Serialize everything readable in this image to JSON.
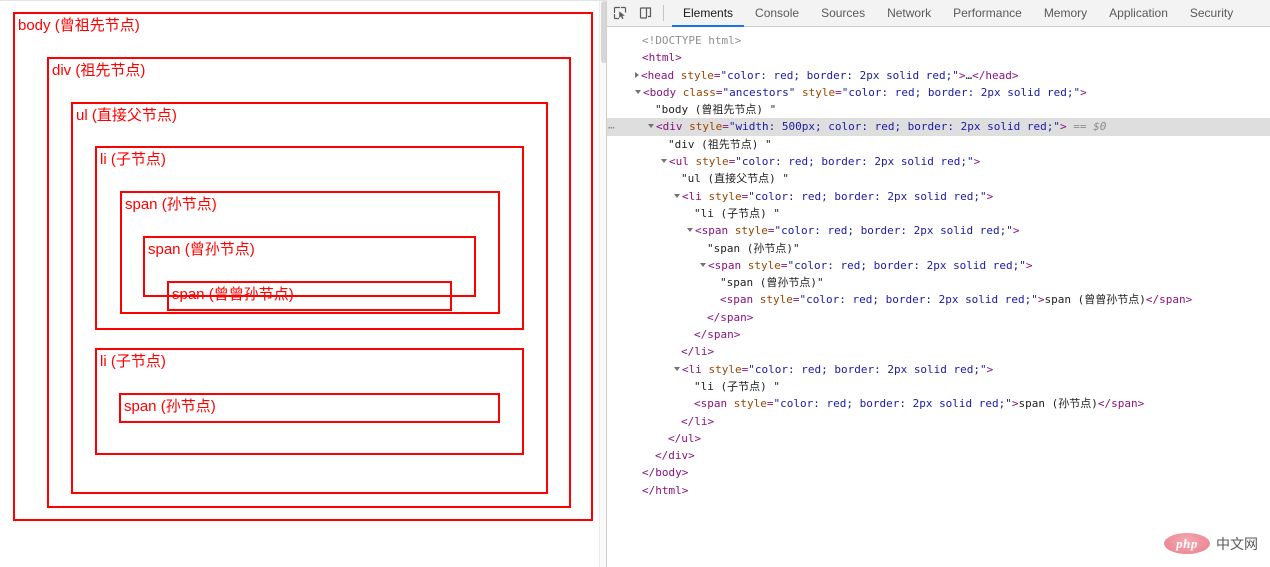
{
  "page_pane": {
    "boxes": {
      "body": "body (曾祖先节点)",
      "div": "div (祖先节点)",
      "ul": "ul (直接父节点)",
      "li_1": "li (子节点)",
      "span_sun_1": "span (孙节点)",
      "span_zengsun": "span (曾孙节点)",
      "span_zengzengsun": "span (曾曾孙节点)",
      "li_2": "li (子节点)",
      "span_sun_2": "span (孙节点)"
    },
    "border_color": "#ff0000",
    "text_color": "#ff0000"
  },
  "devtools": {
    "toolbar": {
      "inspect_icon": "inspect-element-icon",
      "device_icon": "device-toolbar-icon",
      "tabs": [
        {
          "label": "Elements",
          "active": true
        },
        {
          "label": "Console",
          "active": false
        },
        {
          "label": "Sources",
          "active": false
        },
        {
          "label": "Network",
          "active": false
        },
        {
          "label": "Performance",
          "active": false
        },
        {
          "label": "Memory",
          "active": false
        },
        {
          "label": "Application",
          "active": false
        },
        {
          "label": "Security",
          "active": false
        }
      ],
      "accent_color": "#1a73e8"
    },
    "dom_lines": [
      {
        "indent": 0,
        "twisty": "none",
        "selected": false,
        "dots": false,
        "parts": [
          {
            "c": "doctype",
            "t": "<!DOCTYPE html>"
          }
        ]
      },
      {
        "indent": 0,
        "twisty": "none",
        "selected": false,
        "dots": false,
        "parts": [
          {
            "c": "punct",
            "t": "<"
          },
          {
            "c": "tag",
            "t": "html"
          },
          {
            "c": "punct",
            "t": ">"
          }
        ]
      },
      {
        "indent": 0,
        "twisty": "closed",
        "selected": false,
        "dots": false,
        "parts": [
          {
            "c": "punct",
            "t": "<"
          },
          {
            "c": "tag",
            "t": "head"
          },
          {
            "c": "txt",
            "t": " "
          },
          {
            "c": "attrname",
            "t": "style"
          },
          {
            "c": "punct",
            "t": "="
          },
          {
            "c": "attrval",
            "t": "\"color: red; border: 2px solid red;\""
          },
          {
            "c": "punct",
            "t": ">"
          },
          {
            "c": "txt",
            "t": "…"
          },
          {
            "c": "punct",
            "t": "</"
          },
          {
            "c": "tag",
            "t": "head"
          },
          {
            "c": "punct",
            "t": ">"
          }
        ]
      },
      {
        "indent": 0,
        "twisty": "open",
        "selected": false,
        "dots": false,
        "parts": [
          {
            "c": "punct",
            "t": "<"
          },
          {
            "c": "tag",
            "t": "body"
          },
          {
            "c": "txt",
            "t": " "
          },
          {
            "c": "attrname",
            "t": "class"
          },
          {
            "c": "punct",
            "t": "="
          },
          {
            "c": "attrval",
            "t": "\"ancestors\""
          },
          {
            "c": "txt",
            "t": " "
          },
          {
            "c": "attrname",
            "t": "style"
          },
          {
            "c": "punct",
            "t": "="
          },
          {
            "c": "attrval",
            "t": "\"color: red; border: 2px solid red;\""
          },
          {
            "c": "punct",
            "t": ">"
          }
        ]
      },
      {
        "indent": 1,
        "twisty": "none",
        "selected": false,
        "dots": false,
        "parts": [
          {
            "c": "txt",
            "t": "\"body (曾祖先节点) \""
          }
        ]
      },
      {
        "indent": 1,
        "twisty": "open",
        "selected": true,
        "dots": true,
        "parts": [
          {
            "c": "punct",
            "t": "<"
          },
          {
            "c": "tag",
            "t": "div"
          },
          {
            "c": "txt",
            "t": " "
          },
          {
            "c": "attrname",
            "t": "style"
          },
          {
            "c": "punct",
            "t": "="
          },
          {
            "c": "attrval",
            "t": "\"width: 500px; color: red; border: 2px solid red;\""
          },
          {
            "c": "punct",
            "t": ">"
          },
          {
            "c": "dollar",
            "t": " == $0"
          }
        ]
      },
      {
        "indent": 2,
        "twisty": "none",
        "selected": false,
        "dots": false,
        "parts": [
          {
            "c": "txt",
            "t": "\"div (祖先节点) \""
          }
        ]
      },
      {
        "indent": 2,
        "twisty": "open",
        "selected": false,
        "dots": false,
        "parts": [
          {
            "c": "punct",
            "t": "<"
          },
          {
            "c": "tag",
            "t": "ul"
          },
          {
            "c": "txt",
            "t": " "
          },
          {
            "c": "attrname",
            "t": "style"
          },
          {
            "c": "punct",
            "t": "="
          },
          {
            "c": "attrval",
            "t": "\"color: red; border: 2px solid red;\""
          },
          {
            "c": "punct",
            "t": ">"
          }
        ]
      },
      {
        "indent": 3,
        "twisty": "none",
        "selected": false,
        "dots": false,
        "parts": [
          {
            "c": "txt",
            "t": "\"ul (直接父节点) \""
          }
        ]
      },
      {
        "indent": 3,
        "twisty": "open",
        "selected": false,
        "dots": false,
        "parts": [
          {
            "c": "punct",
            "t": "<"
          },
          {
            "c": "tag",
            "t": "li"
          },
          {
            "c": "txt",
            "t": " "
          },
          {
            "c": "attrname",
            "t": "style"
          },
          {
            "c": "punct",
            "t": "="
          },
          {
            "c": "attrval",
            "t": "\"color: red; border: 2px solid red;\""
          },
          {
            "c": "punct",
            "t": ">"
          }
        ]
      },
      {
        "indent": 4,
        "twisty": "none",
        "selected": false,
        "dots": false,
        "parts": [
          {
            "c": "txt",
            "t": "\"li (子节点) \""
          }
        ]
      },
      {
        "indent": 4,
        "twisty": "open",
        "selected": false,
        "dots": false,
        "parts": [
          {
            "c": "punct",
            "t": "<"
          },
          {
            "c": "tag",
            "t": "span"
          },
          {
            "c": "txt",
            "t": " "
          },
          {
            "c": "attrname",
            "t": "style"
          },
          {
            "c": "punct",
            "t": "="
          },
          {
            "c": "attrval",
            "t": "\"color: red; border: 2px solid red;\""
          },
          {
            "c": "punct",
            "t": ">"
          }
        ]
      },
      {
        "indent": 5,
        "twisty": "none",
        "selected": false,
        "dots": false,
        "parts": [
          {
            "c": "txt",
            "t": "\"span (孙节点)\""
          }
        ]
      },
      {
        "indent": 5,
        "twisty": "open",
        "selected": false,
        "dots": false,
        "parts": [
          {
            "c": "punct",
            "t": "<"
          },
          {
            "c": "tag",
            "t": "span"
          },
          {
            "c": "txt",
            "t": " "
          },
          {
            "c": "attrname",
            "t": "style"
          },
          {
            "c": "punct",
            "t": "="
          },
          {
            "c": "attrval",
            "t": "\"color: red; border: 2px solid red;\""
          },
          {
            "c": "punct",
            "t": ">"
          }
        ]
      },
      {
        "indent": 6,
        "twisty": "none",
        "selected": false,
        "dots": false,
        "parts": [
          {
            "c": "txt",
            "t": "\"span (曾孙节点)\""
          }
        ]
      },
      {
        "indent": 6,
        "twisty": "none",
        "selected": false,
        "dots": false,
        "parts": [
          {
            "c": "punct",
            "t": "<"
          },
          {
            "c": "tag",
            "t": "span"
          },
          {
            "c": "txt",
            "t": " "
          },
          {
            "c": "attrname",
            "t": "style"
          },
          {
            "c": "punct",
            "t": "="
          },
          {
            "c": "attrval",
            "t": "\"color: red; border: 2px solid red;\""
          },
          {
            "c": "punct",
            "t": ">"
          },
          {
            "c": "txt",
            "t": "span (曾曾孙节点)"
          },
          {
            "c": "punct",
            "t": "</"
          },
          {
            "c": "tag",
            "t": "span"
          },
          {
            "c": "punct",
            "t": ">"
          }
        ]
      },
      {
        "indent": 5,
        "twisty": "none",
        "selected": false,
        "dots": false,
        "parts": [
          {
            "c": "punct",
            "t": "</"
          },
          {
            "c": "tag",
            "t": "span"
          },
          {
            "c": "punct",
            "t": ">"
          }
        ]
      },
      {
        "indent": 4,
        "twisty": "none",
        "selected": false,
        "dots": false,
        "parts": [
          {
            "c": "punct",
            "t": "</"
          },
          {
            "c": "tag",
            "t": "span"
          },
          {
            "c": "punct",
            "t": ">"
          }
        ]
      },
      {
        "indent": 3,
        "twisty": "none",
        "selected": false,
        "dots": false,
        "parts": [
          {
            "c": "punct",
            "t": "</"
          },
          {
            "c": "tag",
            "t": "li"
          },
          {
            "c": "punct",
            "t": ">"
          }
        ]
      },
      {
        "indent": 3,
        "twisty": "open",
        "selected": false,
        "dots": false,
        "parts": [
          {
            "c": "punct",
            "t": "<"
          },
          {
            "c": "tag",
            "t": "li"
          },
          {
            "c": "txt",
            "t": " "
          },
          {
            "c": "attrname",
            "t": "style"
          },
          {
            "c": "punct",
            "t": "="
          },
          {
            "c": "attrval",
            "t": "\"color: red; border: 2px solid red;\""
          },
          {
            "c": "punct",
            "t": ">"
          }
        ]
      },
      {
        "indent": 4,
        "twisty": "none",
        "selected": false,
        "dots": false,
        "parts": [
          {
            "c": "txt",
            "t": "\"li (子节点) \""
          }
        ]
      },
      {
        "indent": 4,
        "twisty": "none",
        "selected": false,
        "dots": false,
        "parts": [
          {
            "c": "punct",
            "t": "<"
          },
          {
            "c": "tag",
            "t": "span"
          },
          {
            "c": "txt",
            "t": " "
          },
          {
            "c": "attrname",
            "t": "style"
          },
          {
            "c": "punct",
            "t": "="
          },
          {
            "c": "attrval",
            "t": "\"color: red; border: 2px solid red;\""
          },
          {
            "c": "punct",
            "t": ">"
          },
          {
            "c": "txt",
            "t": "span (孙节点)"
          },
          {
            "c": "punct",
            "t": "</"
          },
          {
            "c": "tag",
            "t": "span"
          },
          {
            "c": "punct",
            "t": ">"
          }
        ]
      },
      {
        "indent": 3,
        "twisty": "none",
        "selected": false,
        "dots": false,
        "parts": [
          {
            "c": "punct",
            "t": "</"
          },
          {
            "c": "tag",
            "t": "li"
          },
          {
            "c": "punct",
            "t": ">"
          }
        ]
      },
      {
        "indent": 2,
        "twisty": "none",
        "selected": false,
        "dots": false,
        "parts": [
          {
            "c": "punct",
            "t": "</"
          },
          {
            "c": "tag",
            "t": "ul"
          },
          {
            "c": "punct",
            "t": ">"
          }
        ]
      },
      {
        "indent": 1,
        "twisty": "none",
        "selected": false,
        "dots": false,
        "parts": [
          {
            "c": "punct",
            "t": "</"
          },
          {
            "c": "tag",
            "t": "div"
          },
          {
            "c": "punct",
            "t": ">"
          }
        ]
      },
      {
        "indent": 0,
        "twisty": "none",
        "selected": false,
        "dots": false,
        "parts": [
          {
            "c": "punct",
            "t": "</"
          },
          {
            "c": "tag",
            "t": "body"
          },
          {
            "c": "punct",
            "t": ">"
          }
        ]
      },
      {
        "indent": -1,
        "twisty": "none",
        "selected": false,
        "dots": false,
        "parts": [
          {
            "c": "punct",
            "t": "</"
          },
          {
            "c": "tag",
            "t": "html"
          },
          {
            "c": "punct",
            "t": ">"
          }
        ]
      }
    ]
  },
  "watermark": {
    "logo": "php",
    "text": "中文网"
  }
}
